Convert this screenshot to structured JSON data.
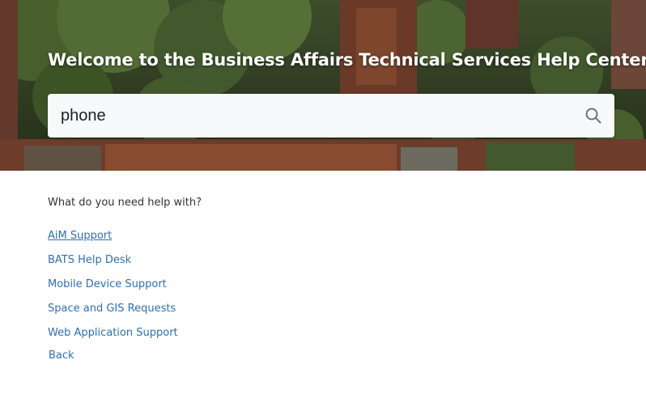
{
  "hero": {
    "title": "Welcome to the Business Affairs Technical Services Help Center"
  },
  "search": {
    "value": "phone",
    "placeholder": "",
    "button_icon": "search-icon"
  },
  "help": {
    "prompt": "What do you need help with?",
    "links": [
      {
        "label": "AiM Support"
      },
      {
        "label": "BATS Help Desk"
      },
      {
        "label": "Mobile Device Support"
      },
      {
        "label": "Space and GIS Requests"
      },
      {
        "label": "Web Application Support"
      }
    ],
    "back_label": "Back"
  },
  "colors": {
    "link": "#2f6fb5",
    "text": "#333333",
    "hero_text": "#ffffff"
  }
}
